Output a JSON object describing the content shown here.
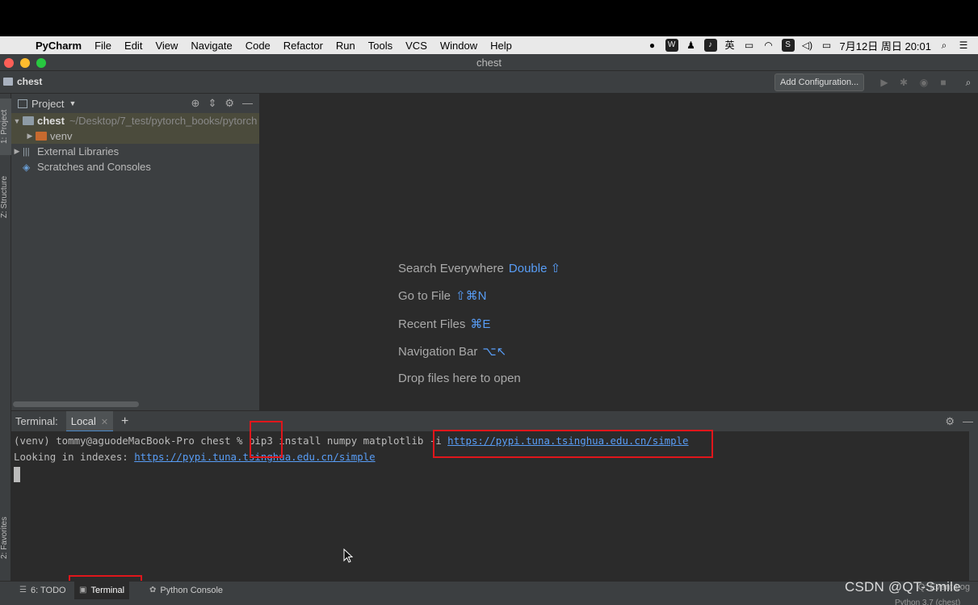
{
  "menubar": {
    "app_name": "PyCharm",
    "menus": [
      "File",
      "Edit",
      "View",
      "Navigate",
      "Code",
      "Refactor",
      "Run",
      "Tools",
      "VCS",
      "Window",
      "Help"
    ],
    "status_icons": [
      "record-icon",
      "wps-icon",
      "qq-icon",
      "mic-icon",
      "input-method-icon",
      "keyboard-icon",
      "wifi-icon",
      "s-app-icon",
      "volume-icon",
      "battery-icon"
    ],
    "input_method": "英",
    "datetime": "7月12日 周日  20:01"
  },
  "window": {
    "title": "chest",
    "traffic_lights": [
      "#fe5f57",
      "#febc2e",
      "#28c840"
    ]
  },
  "navbar": {
    "breadcrumb": "chest",
    "add_configuration": "Add Configuration..."
  },
  "left_stripe": {
    "project_tab": "1: Project",
    "structure_tab": "Z: Structure",
    "favorites_tab": "2: Favorites"
  },
  "project_panel": {
    "header": "Project",
    "tree": [
      {
        "name": "chest",
        "path": "~/Desktop/7_test/pytorch_books/pytorch"
      },
      {
        "name": "venv"
      },
      {
        "name": "External Libraries"
      },
      {
        "name": "Scratches and Consoles"
      }
    ]
  },
  "editor_hints": [
    {
      "label": "Search Everywhere",
      "key": "Double ⇧"
    },
    {
      "label": "Go to File",
      "key": "⇧⌘N"
    },
    {
      "label": "Recent Files",
      "key": "⌘E"
    },
    {
      "label": "Navigation Bar",
      "key": "⌥↖"
    },
    {
      "label": "Drop files here to open",
      "key": ""
    }
  ],
  "terminal": {
    "label": "Terminal:",
    "tab": "Local",
    "prompt": "(venv) tommy@aguodeMacBook-Pro chest % ",
    "command_pip": "pip3",
    "command_rest": " install numpy matplotlib -i ",
    "command_url": "https://pypi.tuna.tsinghua.edu.cn/simple",
    "line2_prefix": "Looking in indexes: ",
    "line2_url": "https://pypi.tuna.tsinghua.edu.cn/simple"
  },
  "bottom_bar": {
    "todo": "6: TODO",
    "terminal": "Terminal",
    "python_console": "Python Console",
    "status_right": "Q: Event Log",
    "interpreter": "Python 3.7 (chest)"
  },
  "annotation_color": "#e0161b",
  "watermark": "CSDN @QT-Smile"
}
